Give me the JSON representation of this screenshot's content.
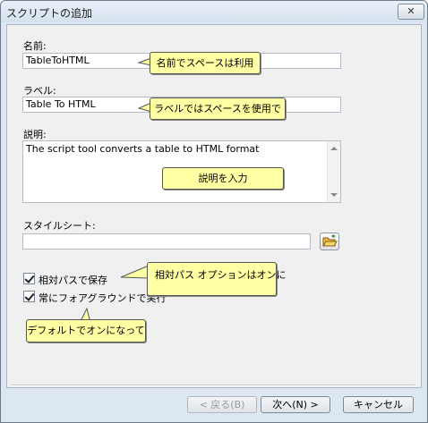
{
  "window": {
    "title": "スクリプトの追加",
    "close_glyph": "✕"
  },
  "name": {
    "label": "名前:",
    "value": "TableToHTML"
  },
  "label_field": {
    "label": "ラベル:",
    "value": "Table To HTML"
  },
  "description": {
    "label": "説明:",
    "value": "The script tool converts a table to HTML format"
  },
  "stylesheet": {
    "label": "スタイルシート:",
    "value": ""
  },
  "options": {
    "relative_paths": {
      "label": "相対パスで保存",
      "checked": true
    },
    "always_foreground": {
      "label": "常にフォアグラウンドで実行",
      "checked": true
    }
  },
  "callouts": {
    "name_note": "名前でスペースは利用",
    "label_note": "ラベルではスペースを使用で",
    "description_note": "説明を入力",
    "relative_note": "相対パス オプションはオンに",
    "foreground_note": "デフォルトでオンになって"
  },
  "buttons": {
    "back": "< 戻る(B)",
    "next": "次へ(N) >",
    "cancel": "キャンセル"
  },
  "colors": {
    "callout_fill": "#ffffa3",
    "window_frame": "#dde7f2",
    "panel": "#f0f0f0"
  },
  "icons": {
    "browse": "folder-open-icon",
    "close": "close-icon"
  }
}
